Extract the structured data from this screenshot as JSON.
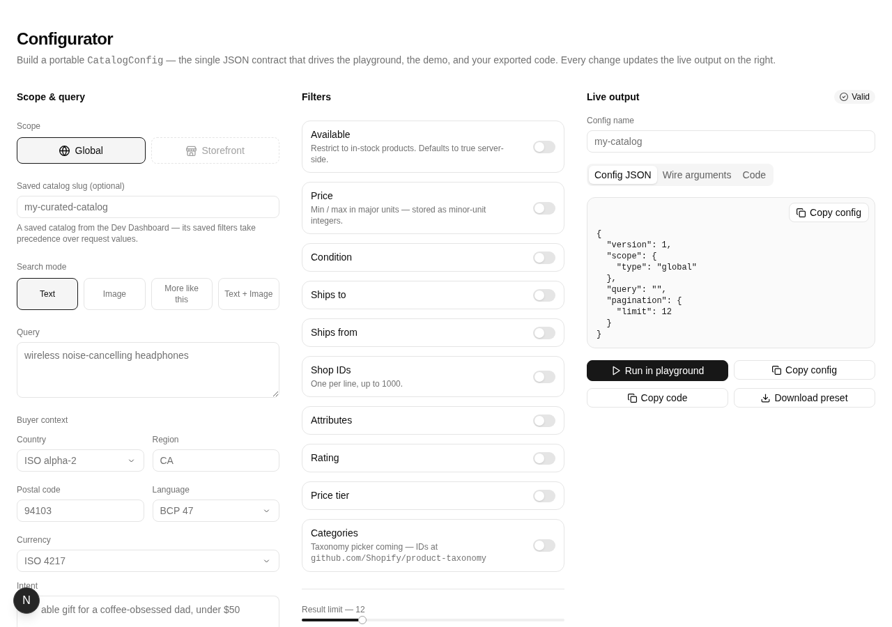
{
  "header": {
    "title": "Configurator",
    "description": [
      {
        "kind": "text",
        "text": "Build a portable "
      },
      {
        "kind": "code",
        "text": "CatalogConfig"
      },
      {
        "kind": "text",
        "text": " — the single JSON contract that drives the playground, the demo, and your exported code. Every change updates the live output on the right."
      }
    ]
  },
  "scope_query": {
    "heading": "Scope & query",
    "scope": {
      "label": "Scope",
      "options": [
        {
          "label": "Global",
          "selected": true,
          "disabled": false
        },
        {
          "label": "Storefront",
          "selected": false,
          "disabled": true
        }
      ]
    },
    "slug": {
      "label": "Saved catalog slug (optional)",
      "placeholder": "my-curated-catalog",
      "help": "A saved catalog from the Dev Dashboard — its saved filters take precedence over request values."
    },
    "search_mode": {
      "label": "Search mode",
      "options": [
        {
          "label": "Text",
          "selected": true
        },
        {
          "label": "Image",
          "selected": false
        },
        {
          "label": "More like this",
          "selected": false
        },
        {
          "label": "Text + Image",
          "selected": false
        }
      ]
    },
    "query": {
      "label": "Query",
      "placeholder": "wireless noise-cancelling headphones"
    },
    "buyer_context": {
      "label": "Buyer context",
      "rows": [
        [
          {
            "kind": "select",
            "label": "Country",
            "placeholder": "ISO alpha-2"
          },
          {
            "kind": "input",
            "label": "Region",
            "placeholder": "CA"
          }
        ],
        [
          {
            "kind": "input",
            "label": "Postal code",
            "placeholder": "94103"
          },
          {
            "kind": "select",
            "label": "Language",
            "placeholder": "BCP 47"
          }
        ],
        [
          {
            "kind": "select",
            "label": "Currency",
            "placeholder": "ISO 4217"
          }
        ]
      ]
    },
    "intent": {
      "label": "Intent",
      "placeholder": "able gift for a coffee-obsessed dad, under $50"
    }
  },
  "filters": {
    "heading": "Filters",
    "items": [
      {
        "title": "Available",
        "description": [
          {
            "kind": "text",
            "text": "Restrict to in-stock products. Defaults to true server-side."
          }
        ],
        "on": false
      },
      {
        "title": "Price",
        "description": [
          {
            "kind": "text",
            "text": "Min / max in major units — stored as minor-unit integers."
          }
        ],
        "on": false
      },
      {
        "title": "Condition",
        "on": false
      },
      {
        "title": "Ships to",
        "on": false
      },
      {
        "title": "Ships from",
        "on": false
      },
      {
        "title": "Shop IDs",
        "description": [
          {
            "kind": "text",
            "text": "One per line, up to 1000."
          }
        ],
        "on": false
      },
      {
        "title": "Attributes",
        "on": false
      },
      {
        "title": "Rating",
        "on": false
      },
      {
        "title": "Price tier",
        "on": false
      },
      {
        "title": "Categories",
        "description": [
          {
            "kind": "text",
            "text": "Taxonomy picker coming — IDs at "
          },
          {
            "kind": "code",
            "text": "github.com/Shopify/product-taxonomy"
          }
        ],
        "on": false
      }
    ],
    "result_limit": {
      "label": "Result limit — 12",
      "level": 0.23
    }
  },
  "live_output": {
    "heading": "Live output",
    "status": {
      "label": "Valid"
    },
    "config_name": {
      "label": "Config name",
      "placeholder": "my-catalog"
    },
    "tabs": [
      {
        "label": "Config JSON",
        "selected": true
      },
      {
        "label": "Wire arguments",
        "selected": false
      },
      {
        "label": "Code",
        "selected": false
      }
    ],
    "code_panel": {
      "copy_button": "Copy config",
      "code": "{\n  \"version\": 1,\n  \"scope\": {\n    \"type\": \"global\"\n  },\n  \"query\": \"\",\n  \"pagination\": {\n    \"limit\": 12\n  }\n}"
    },
    "actions": [
      {
        "label": "Run in playground",
        "kind": "run"
      },
      {
        "label": "Copy config",
        "kind": "copy"
      },
      {
        "label": "Copy code",
        "kind": "copy"
      },
      {
        "label": "Download preset",
        "kind": "download"
      }
    ]
  },
  "dev_badge": {
    "label": "N"
  }
}
